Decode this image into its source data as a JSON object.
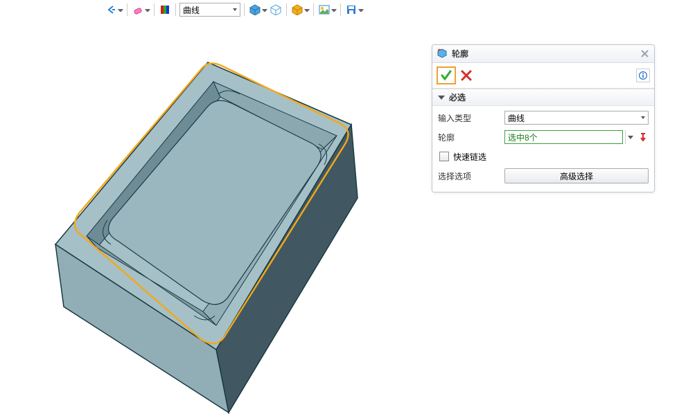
{
  "toolbar": {
    "combo_value": "曲线"
  },
  "panel": {
    "title": "轮廓",
    "section_required": "必选",
    "input_type_label": "输入类型",
    "input_type_value": "曲线",
    "profile_label": "轮廓",
    "profile_value": "选中8个",
    "quick_chain_label": "快速链选",
    "select_options_label": "选择选项",
    "advanced_select": "高级选择"
  }
}
